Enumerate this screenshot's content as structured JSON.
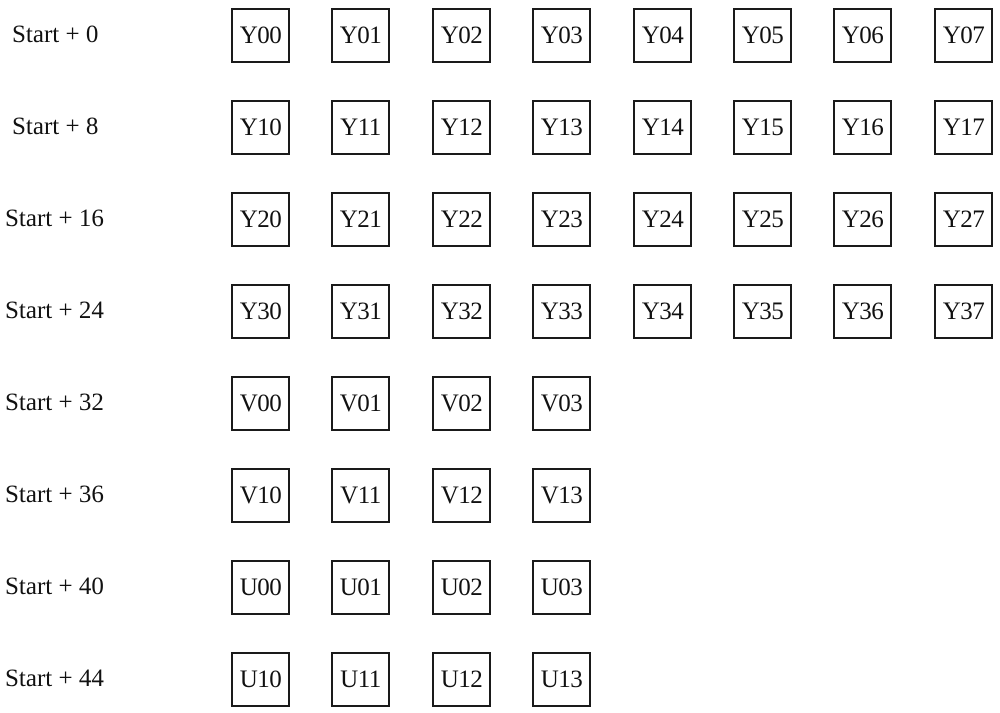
{
  "rows": [
    {
      "label": "Start + 0",
      "cells": [
        "Y00",
        "Y01",
        "Y02",
        "Y03",
        "Y04",
        "Y05",
        "Y06",
        "Y07"
      ]
    },
    {
      "label": "Start + 8",
      "cells": [
        "Y10",
        "Y11",
        "Y12",
        "Y13",
        "Y14",
        "Y15",
        "Y16",
        "Y17"
      ]
    },
    {
      "label": "Start + 16",
      "cells": [
        "Y20",
        "Y21",
        "Y22",
        "Y23",
        "Y24",
        "Y25",
        "Y26",
        "Y27"
      ]
    },
    {
      "label": "Start + 24",
      "cells": [
        "Y30",
        "Y31",
        "Y32",
        "Y33",
        "Y34",
        "Y35",
        "Y36",
        "Y37"
      ]
    },
    {
      "label": "Start + 32",
      "cells": [
        "V00",
        "V01",
        "V02",
        "V03"
      ]
    },
    {
      "label": "Start + 36",
      "cells": [
        "V10",
        "V11",
        "V12",
        "V13"
      ]
    },
    {
      "label": "Start + 40",
      "cells": [
        "U00",
        "U01",
        "U02",
        "U03"
      ]
    },
    {
      "label": "Start + 44",
      "cells": [
        "U10",
        "U11",
        "U12",
        "U13"
      ]
    }
  ]
}
